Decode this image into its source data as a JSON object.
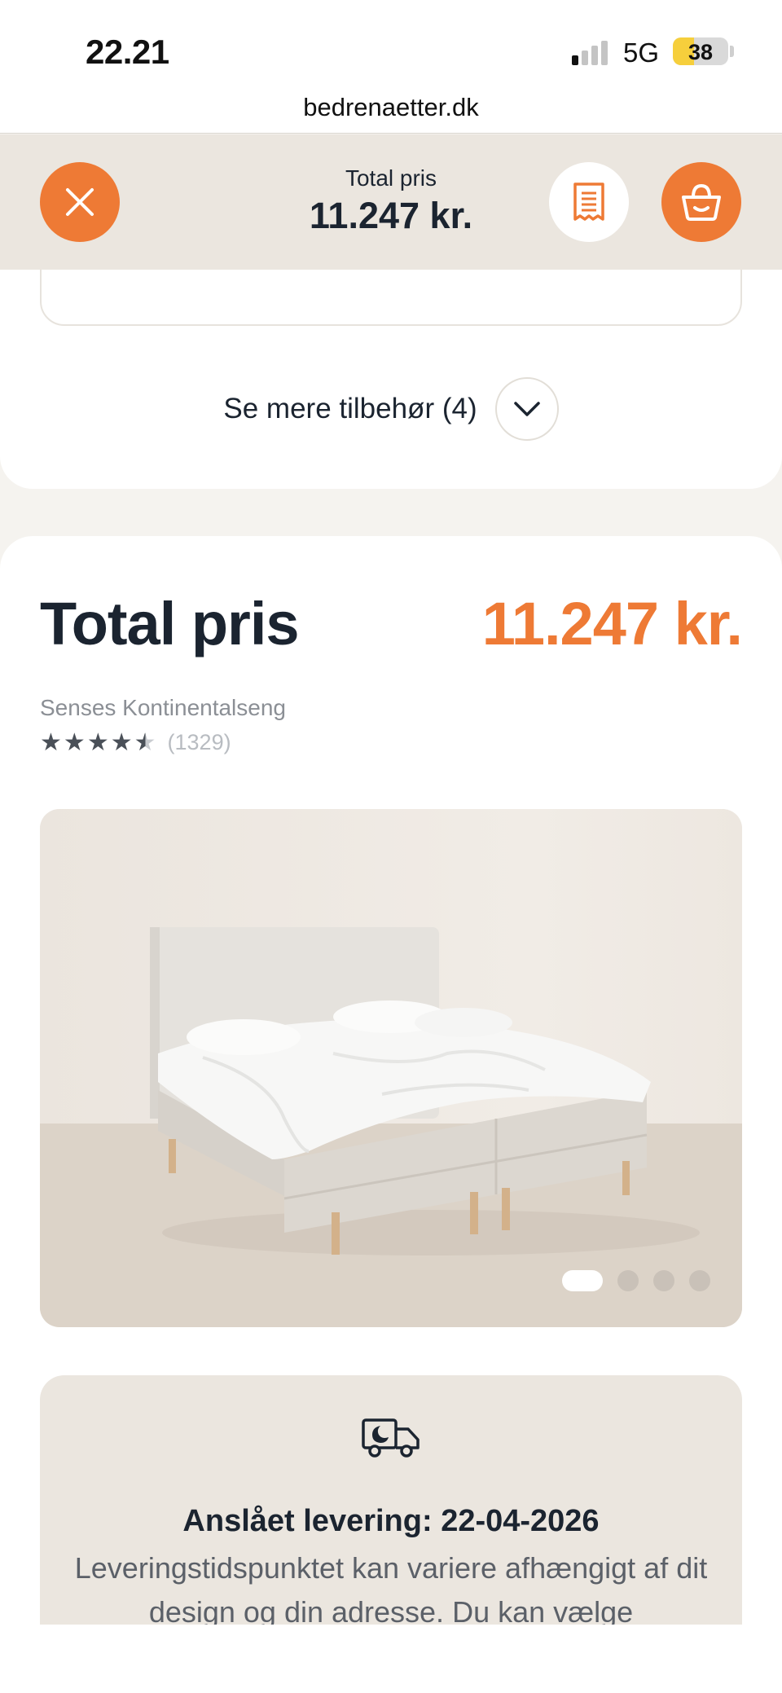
{
  "status_bar": {
    "time": "22.21",
    "network": "5G",
    "battery_level": "38",
    "battery_fraction": 0.38,
    "signal_bars_on": 1,
    "signal_bars_total": 4
  },
  "browser": {
    "url": "bedrenaetter.dk"
  },
  "sticky_header": {
    "price_label": "Total pris",
    "price_value": "11.247 kr.",
    "close_icon": "close-icon",
    "receipt_icon": "receipt-icon",
    "basket_icon": "basket-icon"
  },
  "accessories": {
    "more_label": "Se mere tilbehør (4)"
  },
  "product": {
    "total_label": "Total pris",
    "total_value": "11.247 kr.",
    "name": "Senses Kontinentalseng",
    "rating": 4.5,
    "review_count": "(1329)",
    "gallery_count": 4,
    "gallery_active_index": 0
  },
  "delivery": {
    "title": "Anslået levering: 22-04-2026",
    "text": "Leveringstidspunktet kan variere afhængigt af dit design og din adresse. Du kan vælge"
  },
  "colors": {
    "accent": "#ee7a35",
    "dark_text": "#1b2430",
    "header_bg": "#ebe6df"
  }
}
